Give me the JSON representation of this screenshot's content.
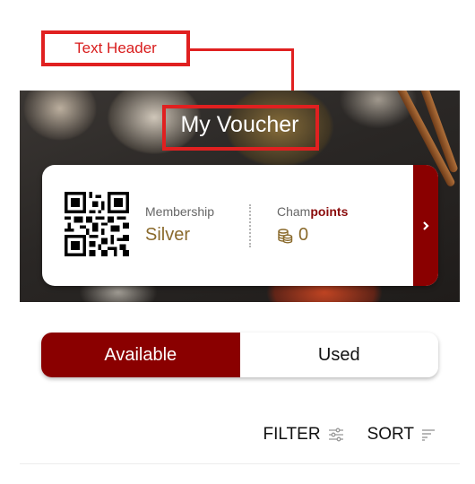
{
  "annotation": {
    "label": "Text Header"
  },
  "header": {
    "title": "My Voucher"
  },
  "membership": {
    "label": "Membership",
    "tier": "Silver",
    "points_label_prefix": "Cham",
    "points_label_highlight": "points",
    "points_value": "0"
  },
  "tabs": [
    {
      "label": "Available",
      "active": true
    },
    {
      "label": "Used",
      "active": false
    }
  ],
  "toolbar": {
    "filter_label": "FILTER",
    "sort_label": "SORT"
  },
  "colors": {
    "accent": "#8a0000",
    "tier": "#8a6a2c",
    "annotation": "#e02020"
  }
}
